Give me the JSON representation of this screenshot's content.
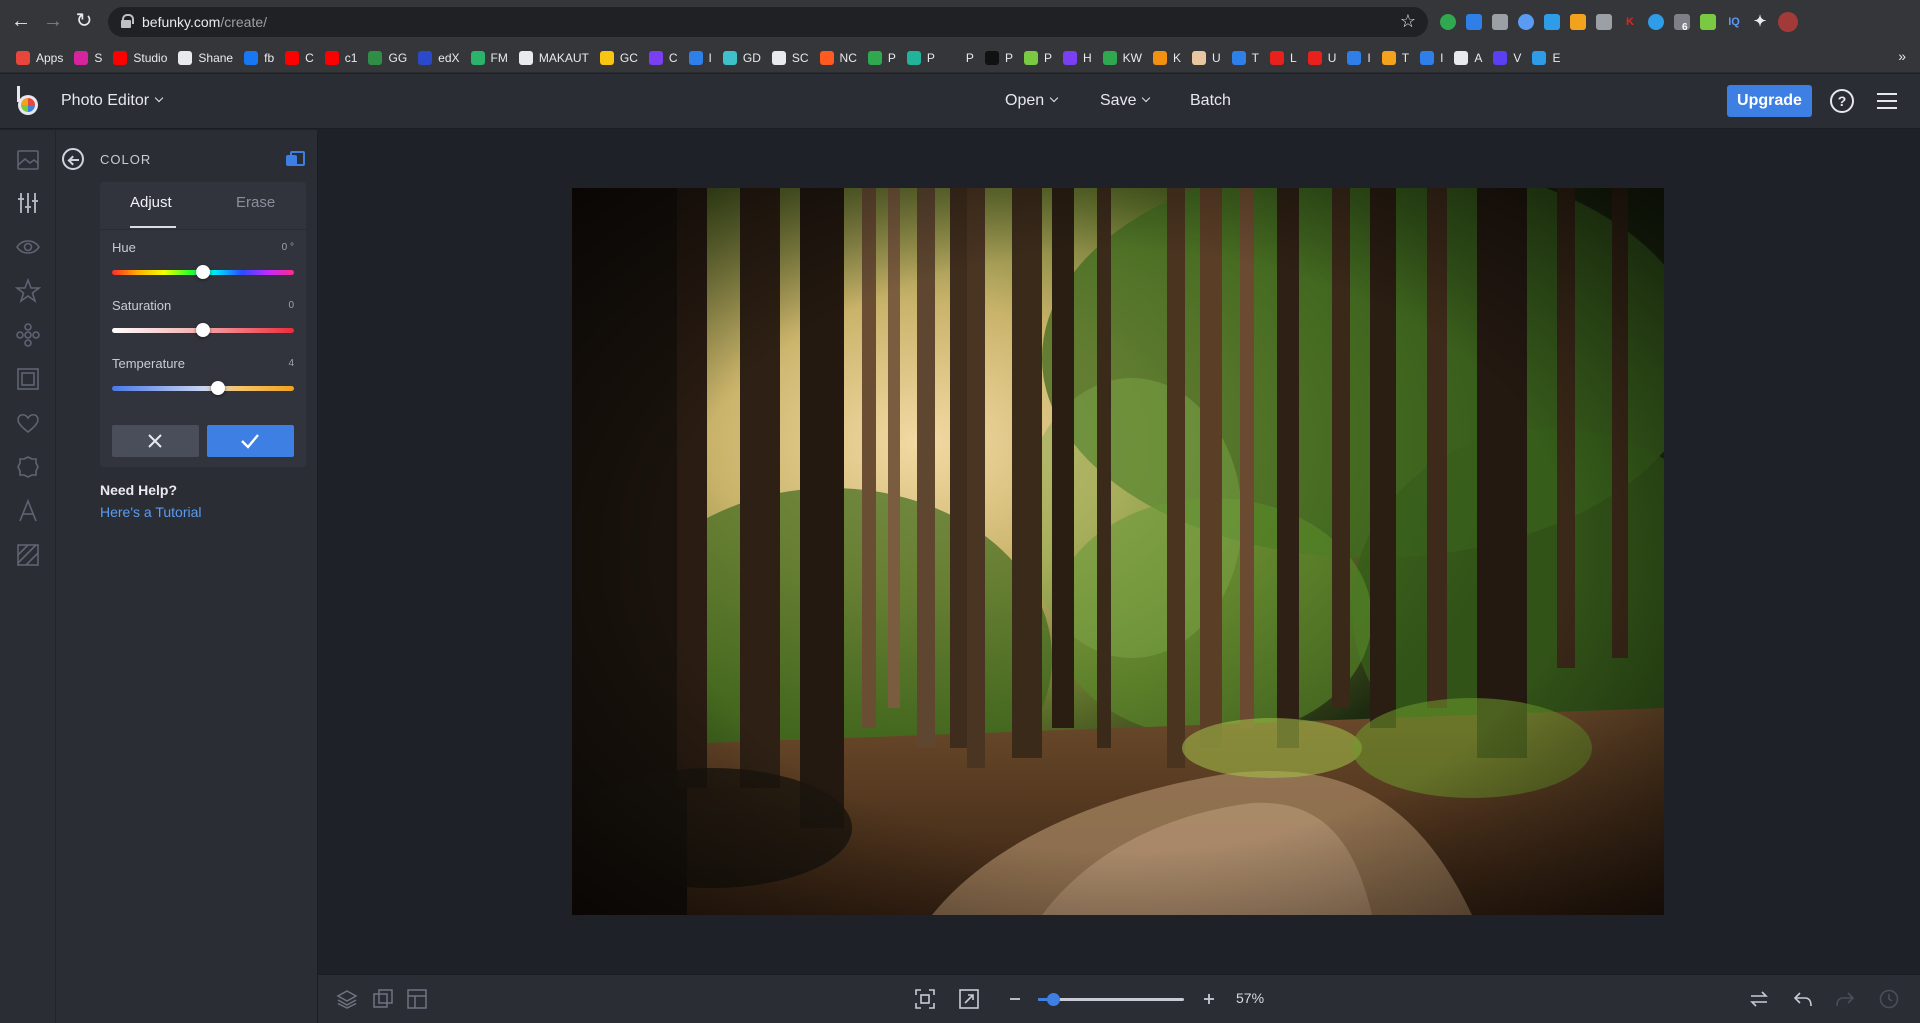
{
  "browser": {
    "url_host": "befunky.com",
    "url_path": "/create/",
    "bookmarks": [
      {
        "label": "Apps",
        "color": "#e8453c"
      },
      {
        "label": "S",
        "color": "#d6249f"
      },
      {
        "label": "Studio",
        "color": "#ff0000"
      },
      {
        "label": "Shane",
        "color": "#e8eaed"
      },
      {
        "label": "fb",
        "color": "#1877f2"
      },
      {
        "label": "C",
        "color": "#ff0000"
      },
      {
        "label": "c1",
        "color": "#ff0000"
      },
      {
        "label": "GG",
        "color": "#2f8d46"
      },
      {
        "label": "edX",
        "color": "#2b4acb"
      },
      {
        "label": "FM",
        "color": "#29b36b"
      },
      {
        "label": "MAKAUT",
        "color": "#e8eaed"
      },
      {
        "label": "GC",
        "color": "#f9c513"
      },
      {
        "label": "C",
        "color": "#7b3ff2"
      },
      {
        "label": "I",
        "color": "#2f7fe8"
      },
      {
        "label": "GD",
        "color": "#3ec1c9"
      },
      {
        "label": "SC",
        "color": "#e8eaed"
      },
      {
        "label": "NC",
        "color": "#ff5a1f"
      },
      {
        "label": "P",
        "color": "#2fa84f"
      },
      {
        "label": "P",
        "color": "#22b39b"
      },
      {
        "label": "P",
        "color": "#35363a"
      },
      {
        "label": "P",
        "color": "#111111"
      },
      {
        "label": "P",
        "color": "#7ac943"
      },
      {
        "label": "H",
        "color": "#7b3ff2"
      },
      {
        "label": "KW",
        "color": "#2fa84f"
      },
      {
        "label": "K",
        "color": "#f29111"
      },
      {
        "label": "U",
        "color": "#e8c7a0"
      },
      {
        "label": "T",
        "color": "#2f7fe8"
      },
      {
        "label": "L",
        "color": "#e8211c"
      },
      {
        "label": "U",
        "color": "#e8211c"
      },
      {
        "label": "I",
        "color": "#2f7fe8"
      },
      {
        "label": "T",
        "color": "#f2a21c"
      },
      {
        "label": "I",
        "color": "#2f7fe8"
      },
      {
        "label": "A",
        "color": "#e8eaed"
      },
      {
        "label": "V",
        "color": "#5b3ff2"
      },
      {
        "label": "E",
        "color": "#2f9ce8"
      }
    ],
    "ext_badge": "6"
  },
  "app": {
    "title": "Photo Editor",
    "menu": {
      "open": "Open",
      "save": "Save",
      "batch": "Batch"
    },
    "upgrade": "Upgrade",
    "help": "?"
  },
  "panel": {
    "title": "COLOR",
    "tabs": {
      "adjust": "Adjust",
      "erase": "Erase"
    },
    "sliders": [
      {
        "label": "Hue",
        "value": "0 °",
        "position": 0.5
      },
      {
        "label": "Saturation",
        "value": "0",
        "position": 0.5
      },
      {
        "label": "Temperature",
        "value": "4",
        "position": 0.58
      }
    ],
    "need_help": "Need Help?",
    "tutorial_link": "Here's a Tutorial"
  },
  "bottom": {
    "zoom_value": "57%",
    "zoom_position": 0.1
  },
  "colors": {
    "accent": "#3d7fe3",
    "panel_bg": "#2b2d35",
    "canvas_bg": "#1f2128"
  }
}
